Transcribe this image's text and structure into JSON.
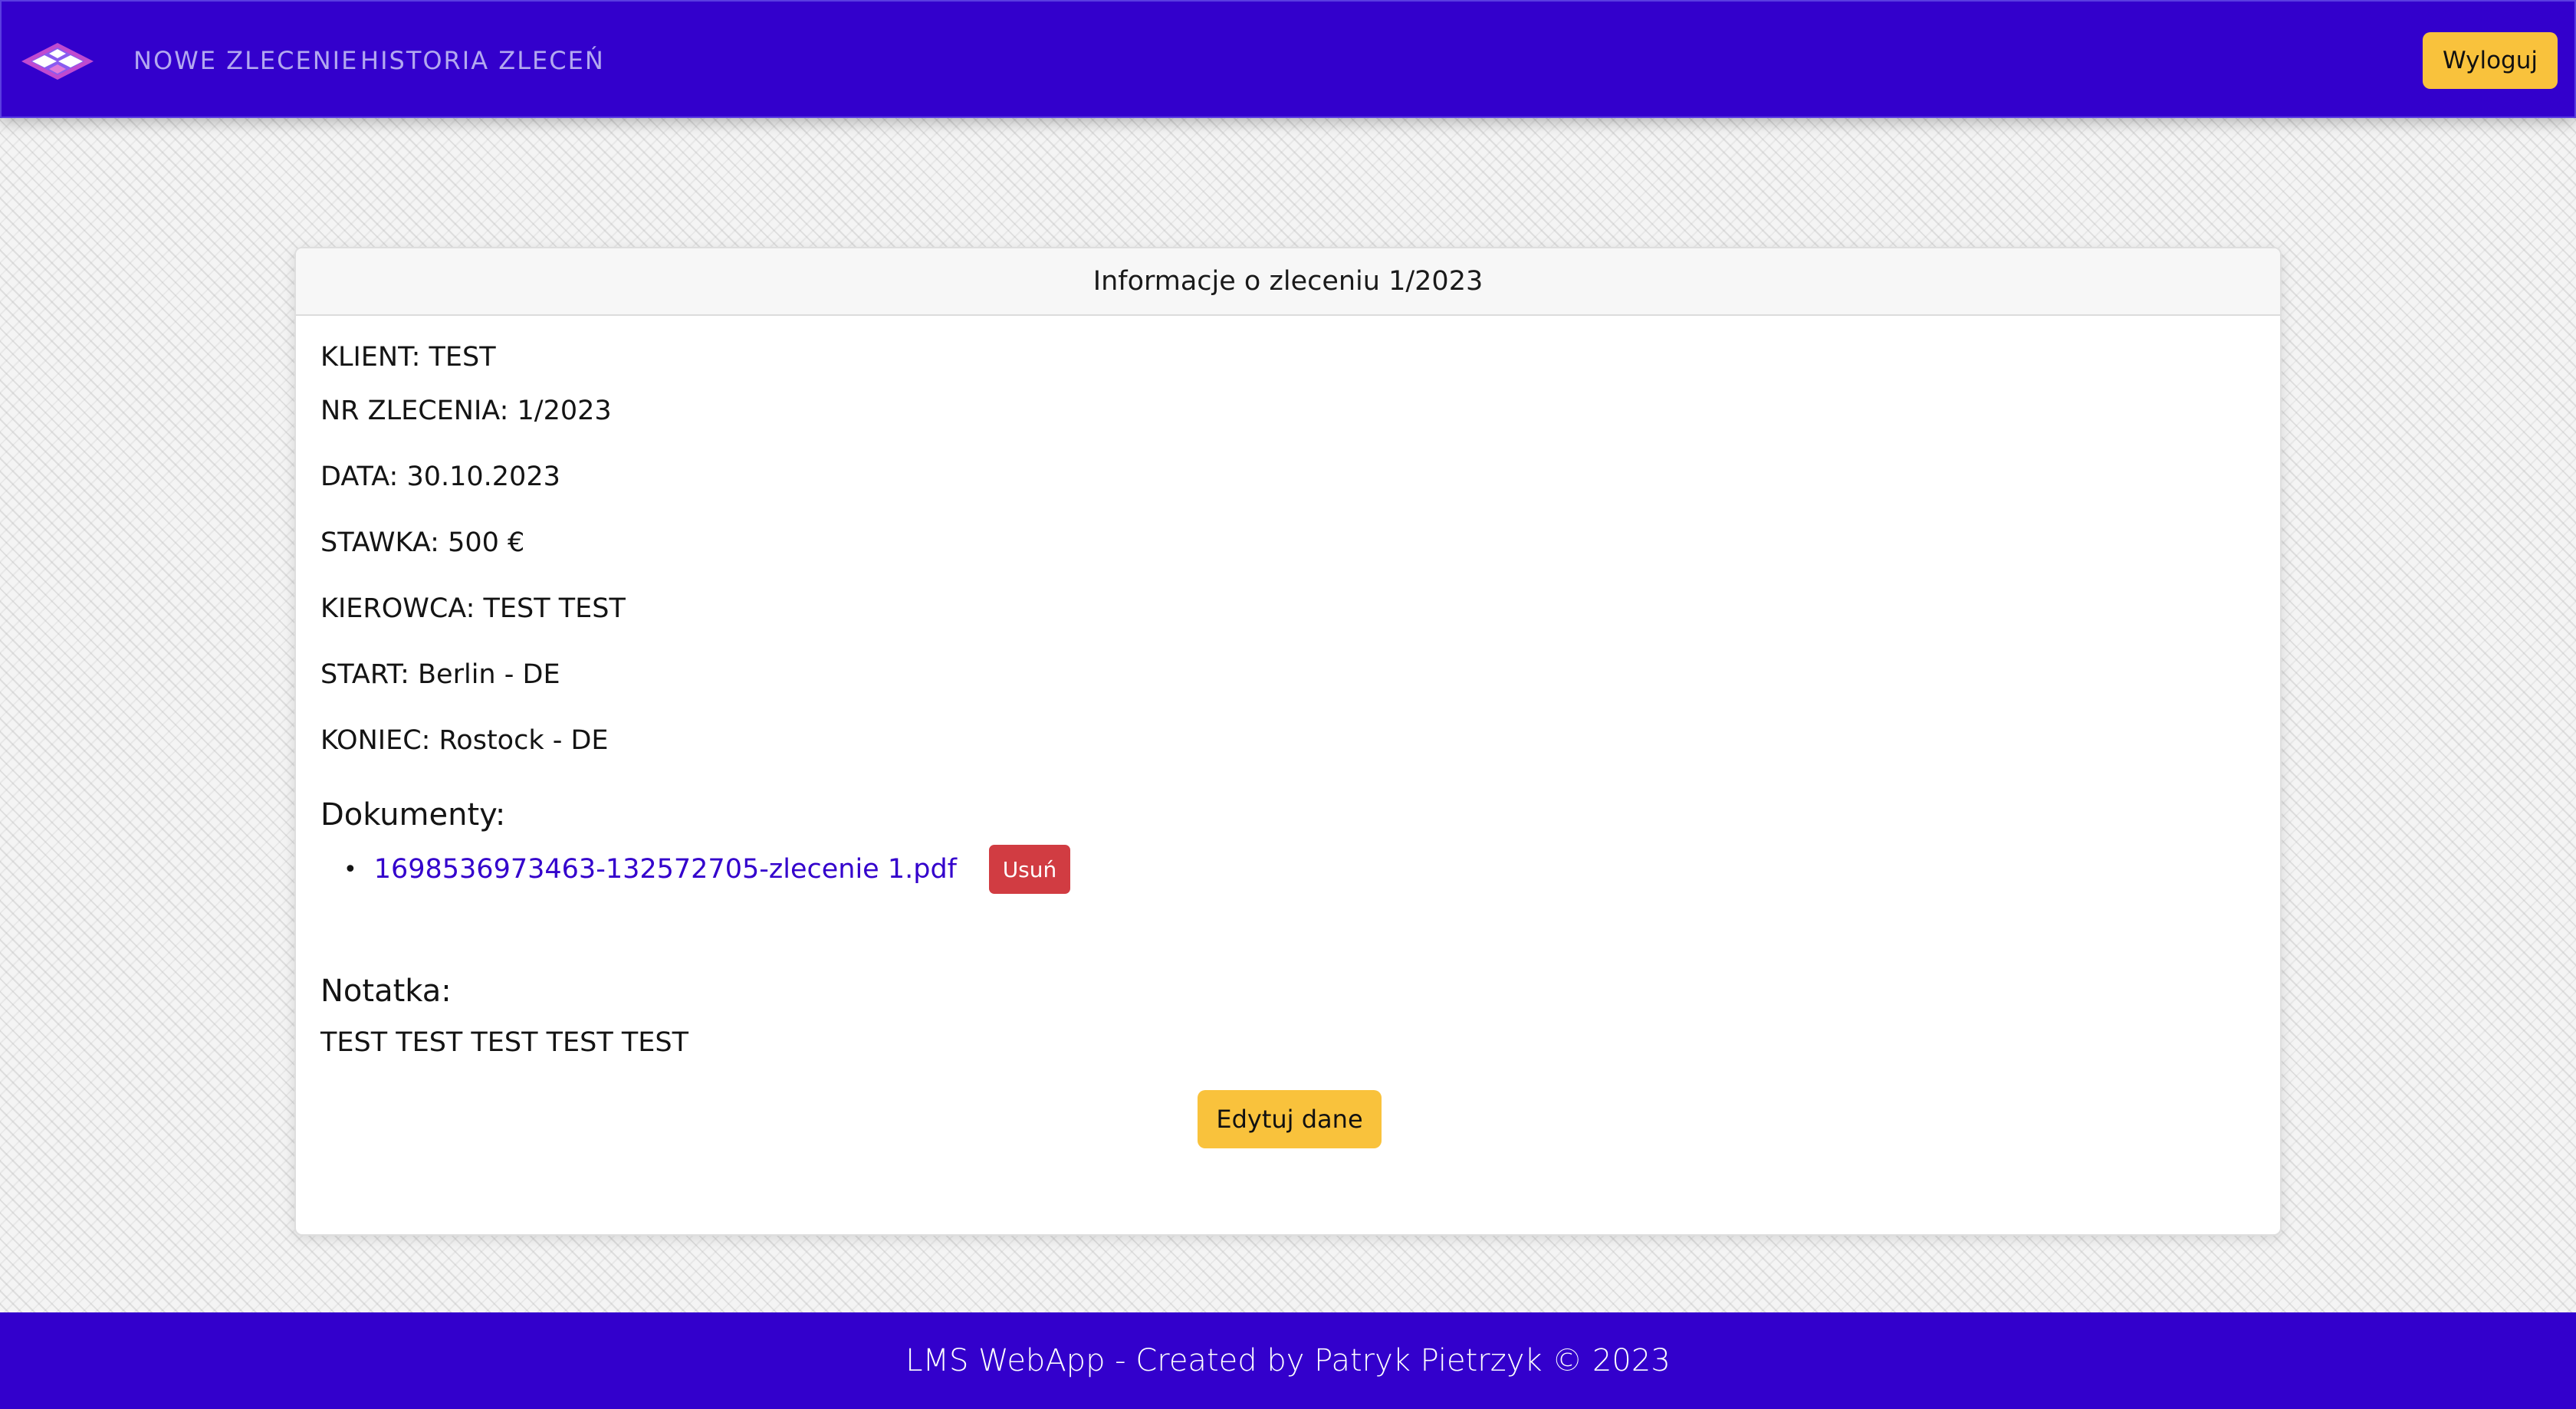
{
  "navbar": {
    "logo_icon": "layers-logo-icon",
    "nav_items": [
      {
        "label": "NOWE ZLECENIE"
      },
      {
        "label": "HISTORIA ZLECEŃ"
      }
    ],
    "logout_label": "Wyloguj"
  },
  "card": {
    "header": "Informacje o zleceniu 1/2023",
    "fields": {
      "client": "KLIENT: TEST",
      "order_number": "NR ZLECENIA: 1/2023",
      "date": "DATA: 30.10.2023",
      "rate": "STAWKA: 500 €",
      "driver": "KIEROWCA: TEST TEST",
      "start": "START: Berlin - DE",
      "end": "KONIEC: Rostock - DE"
    },
    "documents_title": "Dokumenty:",
    "documents": [
      {
        "name": "1698536973463-132572705-zlecenie 1.pdf",
        "delete_label": "Usuń"
      }
    ],
    "note_title": "Notatka:",
    "note_text": "TEST TEST TEST TEST TEST",
    "edit_label": "Edytuj dane"
  },
  "footer": {
    "text": "LMS WebApp - Created by Patryk Pietrzyk © 2023"
  },
  "colors": {
    "brand": "#3300cc",
    "accent": "#f9c23c",
    "danger": "#d13c42",
    "link": "#3300cc"
  }
}
